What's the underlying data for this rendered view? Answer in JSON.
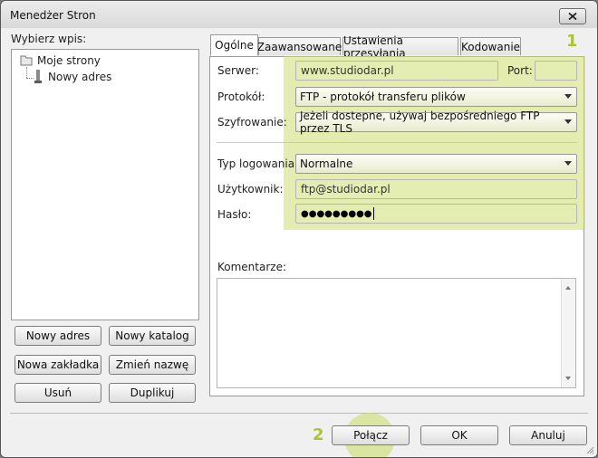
{
  "window": {
    "title": "Menedżer Stron"
  },
  "left": {
    "label": "Wybierz wpis:",
    "tree": {
      "root": "Moje strony",
      "child": "Nowy adres"
    },
    "buttons": {
      "new_site": "Nowy adres",
      "new_folder": "Nowy katalog",
      "new_bookmark": "Nowa zakładka",
      "rename": "Zmień nazwę",
      "delete": "Usuń",
      "duplicate": "Duplikuj"
    }
  },
  "tabs": [
    {
      "label": "Ogólne",
      "active": true
    },
    {
      "label": "Zaawansowane",
      "active": false
    },
    {
      "label": "Ustawienia przesyłania",
      "active": false
    },
    {
      "label": "Kodowanie",
      "active": false
    }
  ],
  "form": {
    "server_label": "Serwer:",
    "server_value": "www.studiodar.pl",
    "port_label": "Port:",
    "port_value": "",
    "protocol_label": "Protokół:",
    "protocol_value": "FTP - protokół transferu plików",
    "encryption_label": "Szyfrowanie:",
    "encryption_value": "Jeżeli dostepne, używaj bezpośredniego FTP przez TLS",
    "logon_label": "Typ logowania:",
    "logon_value": "Normalne",
    "user_label": "Użytkownik:",
    "user_value": "ftp@studiodar.pl",
    "password_label": "Hasło:",
    "password_value": "●●●●●●●●●",
    "comments_label": "Komentarze:",
    "comments_value": ""
  },
  "footer": {
    "connect": "Połącz",
    "ok": "OK",
    "cancel": "Anuluj"
  },
  "callouts": {
    "one": "1",
    "two": "2"
  },
  "colors": {
    "highlight": "#cdde6e",
    "callout": "#a9c435"
  }
}
